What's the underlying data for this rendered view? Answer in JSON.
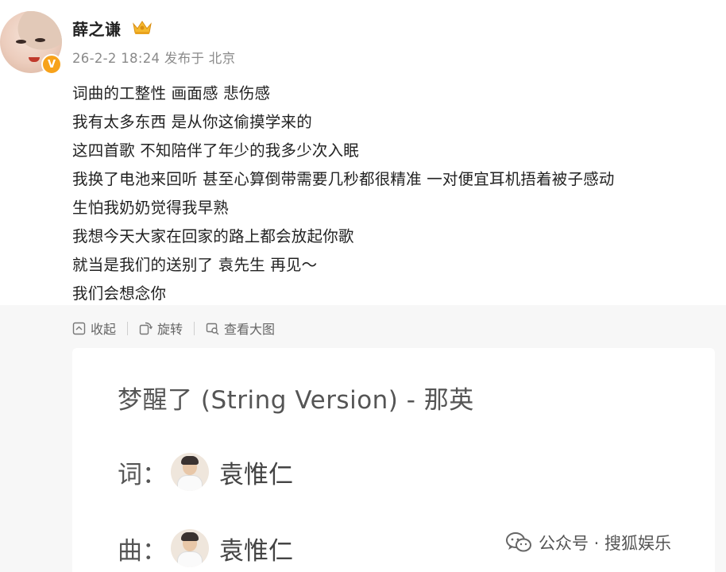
{
  "post": {
    "username": "薛之谦",
    "meta": "26-2-2 18:24  发布于 北京",
    "verified_badge": "V",
    "lines": [
      "词曲的工整性 画面感 悲伤感",
      "我有太多东西 是从你这偷摸学来的",
      "这四首歌 不知陪伴了年少的我多少次入眠",
      "我换了电池来回听 甚至心算倒带需要几秒都很精准 一对便宜耳机捂着被子感动",
      "生怕我奶奶觉得我早熟",
      "我想今天大家在回家的路上都会放起你歌",
      "就当是我们的送别了 袁先生 再见～",
      "我们会想念你"
    ]
  },
  "actions": {
    "collapse": "收起",
    "rotate": "旋转",
    "view_large": "查看大图"
  },
  "card": {
    "song_title": "梦醒了 (String Version) - 那英",
    "lyricist_label": "词：",
    "lyricist_name": "袁惟仁",
    "composer_label": "曲：",
    "composer_name": "袁惟仁"
  },
  "watermark": {
    "text": "公众号 · 搜狐娱乐"
  },
  "colors": {
    "badge": "#f7a21b",
    "text": "#222222",
    "meta": "#8a8a8a",
    "panel": "#f7f7f7"
  }
}
